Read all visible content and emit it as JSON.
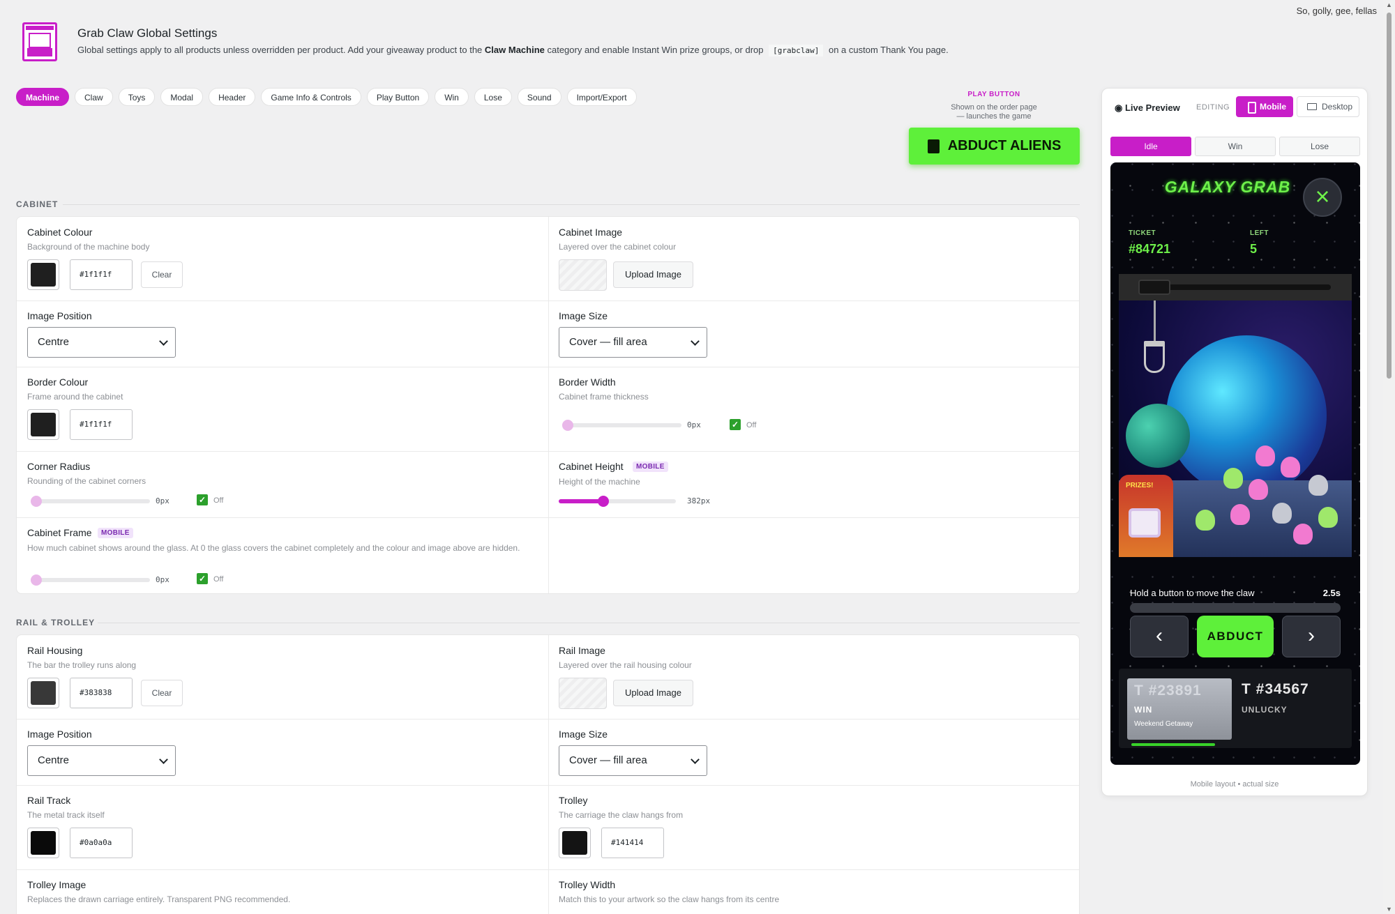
{
  "topnote": "So, golly, gee, fellas",
  "header": {
    "title": "Grab Claw Global Settings",
    "desc_1": "Global settings apply to all products unless overridden per product. Add your giveaway product to the ",
    "desc_bold": "Claw Machine",
    "desc_2": " category and enable Instant Win prize groups, or drop ",
    "desc_code": "[grabclaw]",
    "desc_3": " on a custom Thank You page."
  },
  "tabs": [
    "Machine",
    "Claw",
    "Toys",
    "Modal",
    "Header",
    "Game Info & Controls",
    "Play Button",
    "Win",
    "Lose",
    "Sound",
    "Import/Export"
  ],
  "play_button": {
    "label": "PLAY BUTTON",
    "sub_1": "Shown on the order page",
    "sub_2": "— launches the game",
    "text": "ABDUCT ALIENS"
  },
  "cabinet": {
    "section": "CABINET",
    "colour_label": "Cabinet Colour",
    "colour_desc": "Background of the machine body",
    "colour_hex": "#1f1f1f",
    "clear": "Clear",
    "image_label": "Cabinet Image",
    "image_desc": "Layered over the cabinet colour",
    "upload": "Upload Image",
    "pos_label": "Image Position",
    "pos_value": "Centre",
    "size_label": "Image Size",
    "size_value": "Cover — fill area",
    "border_label": "Border Colour",
    "border_desc": "Frame around the cabinet",
    "border_hex": "#1f1f1f",
    "bwidth_label": "Border Width",
    "bwidth_desc": "Cabinet frame thickness",
    "bwidth_value": "0px",
    "off": "Off",
    "radius_label": "Corner Radius",
    "radius_desc": "Rounding of the cabinet corners",
    "radius_value": "0px",
    "height_label": "Cabinet Height",
    "height_badge": "MOBILE",
    "height_desc": "Height of the machine",
    "height_value": "382px",
    "height_fraction": 0.38,
    "frame_label": "Cabinet Frame",
    "frame_badge": "MOBILE",
    "frame_desc": "How much cabinet shows around the glass. At 0 the glass covers the cabinet completely and the colour and image above are hidden.",
    "frame_value": "0px"
  },
  "rail": {
    "section": "RAIL & TROLLEY",
    "housing_label": "Rail Housing",
    "housing_desc": "The bar the trolley runs along",
    "housing_hex": "#383838",
    "clear": "Clear",
    "image_label": "Rail Image",
    "image_desc": "Layered over the rail housing colour",
    "upload": "Upload Image",
    "pos_label": "Image Position",
    "pos_value": "Centre",
    "size_label": "Image Size",
    "size_value": "Cover — fill area",
    "track_label": "Rail Track",
    "track_desc": "The metal track itself",
    "track_hex": "#0a0a0a",
    "trolley_label": "Trolley",
    "trolley_desc": "The carriage the claw hangs from",
    "trolley_hex": "#141414",
    "timg_label": "Trolley Image",
    "timg_desc": "Replaces the drawn carriage entirely. Transparent PNG recommended.",
    "twidth_label": "Trolley Width",
    "twidth_desc": "Match this to your artwork so the claw hangs from its centre"
  },
  "preview": {
    "title": "Live Preview",
    "editing": "EDITING",
    "mobile": "Mobile",
    "desktop": "Desktop",
    "states": [
      "Idle",
      "Win",
      "Lose"
    ],
    "footer": "Mobile layout • actual size",
    "game": {
      "logo": "GALAXY GRAB",
      "close": "×",
      "ticket_label": "TICKET",
      "ticket_value": "#84721",
      "left_label": "LEFT",
      "left_value": "5",
      "prizes": "PRIZES!",
      "hold_text": "Hold a button to move the claw",
      "timer": "2.5s",
      "left_arrow": "‹",
      "right_arrow": "›",
      "abduct": "ABDUCT",
      "ticket1_num": "T #23891",
      "ticket1_result": "WIN",
      "ticket1_prize": "Weekend Getaway",
      "ticket2_num": "T #34567",
      "ticket2_result": "UNLUCKY"
    }
  },
  "colors": {
    "accent": "#c81ec8",
    "play_green": "#5ef03a",
    "cabinet": "#1f1f1f",
    "housing": "#383838",
    "track": "#0a0a0a",
    "trolley": "#141414"
  }
}
